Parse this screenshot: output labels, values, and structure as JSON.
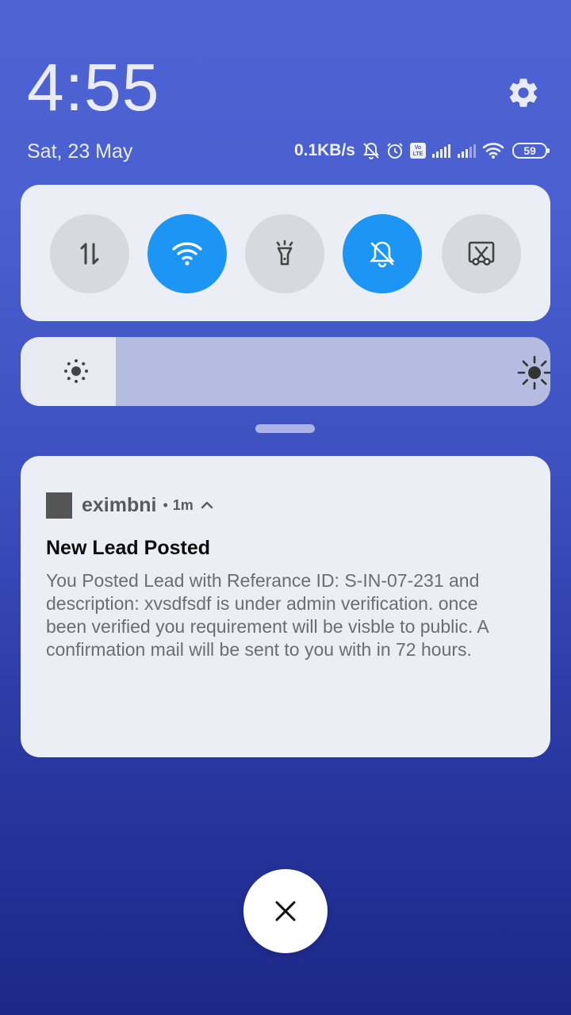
{
  "header": {
    "time": "4:55",
    "date": "Sat, 23 May"
  },
  "status_bar": {
    "net_speed": "0.1KB/s",
    "battery_level": "59",
    "icons": [
      "bell-off-icon",
      "alarm-icon",
      "volte-icon",
      "signal-icon",
      "signal-icon",
      "wifi-icon",
      "battery-icon"
    ]
  },
  "quick_settings": {
    "tiles": [
      {
        "id": "mobile-data",
        "icon": "data-arrows-icon",
        "state": "off"
      },
      {
        "id": "wifi",
        "icon": "wifi-icon",
        "state": "on"
      },
      {
        "id": "flashlight",
        "icon": "flashlight-icon",
        "state": "off"
      },
      {
        "id": "silent",
        "icon": "bell-off-icon",
        "state": "on"
      },
      {
        "id": "screenshot",
        "icon": "scissors-icon",
        "state": "off"
      }
    ],
    "accent_color": "#1d95f4"
  },
  "brightness": {
    "level": 0.18
  },
  "notification": {
    "app_name": "eximbni",
    "time": "1m",
    "title": "New Lead Posted",
    "body_lines": [
      "You Posted Lead with Referance ID: S-IN-07-231 and",
      "description: xvsdfsdf is under admin verification. once",
      "been verified you requirement will be visble to public. A",
      "confirmation mail will be sent to you with in 72 hours."
    ]
  },
  "close_button": {
    "icon": "close-icon"
  }
}
